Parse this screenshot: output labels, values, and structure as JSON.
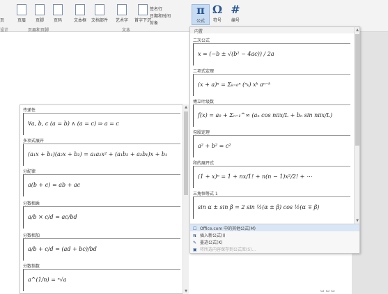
{
  "ribbon": {
    "buttons": [
      {
        "name": "ribbon-button-header",
        "label": "页眉"
      },
      {
        "name": "ribbon-button-footer",
        "label": "页脚"
      },
      {
        "name": "ribbon-button-page-number",
        "label": "页码"
      },
      {
        "name": "ribbon-button-textbox",
        "label": "文本框"
      },
      {
        "name": "ribbon-button-docparts",
        "label": "文档部件"
      },
      {
        "name": "ribbon-button-wordart",
        "label": "艺术字"
      },
      {
        "name": "ribbon-button-dropcap",
        "label": "首字下沉"
      }
    ],
    "small_commands": [
      "签名行",
      "日期和时间",
      "对象"
    ],
    "symbol_buttons": [
      {
        "name": "ribbon-button-equation",
        "glyph": "π",
        "label": "公式"
      },
      {
        "name": "ribbon-button-symbol",
        "glyph": "Ω",
        "label": "符号"
      },
      {
        "name": "ribbon-button-number",
        "glyph": "#",
        "label": "编号"
      }
    ],
    "group_labels": {
      "left": "设计",
      "header_footer": "页眉和页脚",
      "text": "文本"
    },
    "cut_label": "页"
  },
  "gallery": {
    "header": "内置",
    "items": [
      {
        "title": "二次公式",
        "formula": "x = (−b ± √(b² − 4ac)) / 2a"
      },
      {
        "title": "二项式定理",
        "formula": "(x + a)ⁿ = Σₖ₌₀ⁿ (ⁿₖ) xᵏ aⁿ⁻ᵏ"
      },
      {
        "title": "傅立叶级数",
        "formula": "f(x) = a₀ + Σₙ₌₁^∞ (aₙ cos nπx/L + bₙ sin nπx/L)"
      },
      {
        "title": "勾股定理",
        "formula": "a² + b² = c²"
      },
      {
        "title": "和的展开式",
        "formula": "(1 + x)ⁿ = 1 + nx/1! + n(n − 1)x²/2! + ⋯"
      },
      {
        "title": "三角恒等式 1",
        "formula": "sin α ± sin β = 2 sin ½(α ± β) cos ½(α ∓ β)"
      }
    ],
    "footer": [
      {
        "icon": "☐",
        "label": "Office.com 中的其他公式(M)",
        "enabled": true
      },
      {
        "icon": "π",
        "label": "插入新公式(I)",
        "enabled": true
      },
      {
        "icon": "✎",
        "label": "墨迹公式(K)",
        "enabled": true
      },
      {
        "icon": "▣",
        "label": "将所选内容保存到公式库(S)...",
        "enabled": false
      }
    ]
  },
  "panel": {
    "items": [
      {
        "title": "传递性",
        "formula": "∀a, b, c (a = b) ∧ (a = c) ⇒ a = c"
      },
      {
        "title": "多项式展开",
        "formula": "(a₁x + b₁)(a₂x + b₂) = a₁a₂x² + (a₁b₂ + a₂b₁)x + b₁"
      },
      {
        "title": "分配律",
        "formula": "a(b + c) = ab + ac"
      },
      {
        "title": "分数相乘",
        "formula": "a/b × c/d = ac/bd"
      },
      {
        "title": "分数相加",
        "formula": "a/b + c/d = (ad + bc)/bd"
      },
      {
        "title": "分数指数",
        "formula": "a^(1/n) = ⁿ√a"
      }
    ]
  }
}
